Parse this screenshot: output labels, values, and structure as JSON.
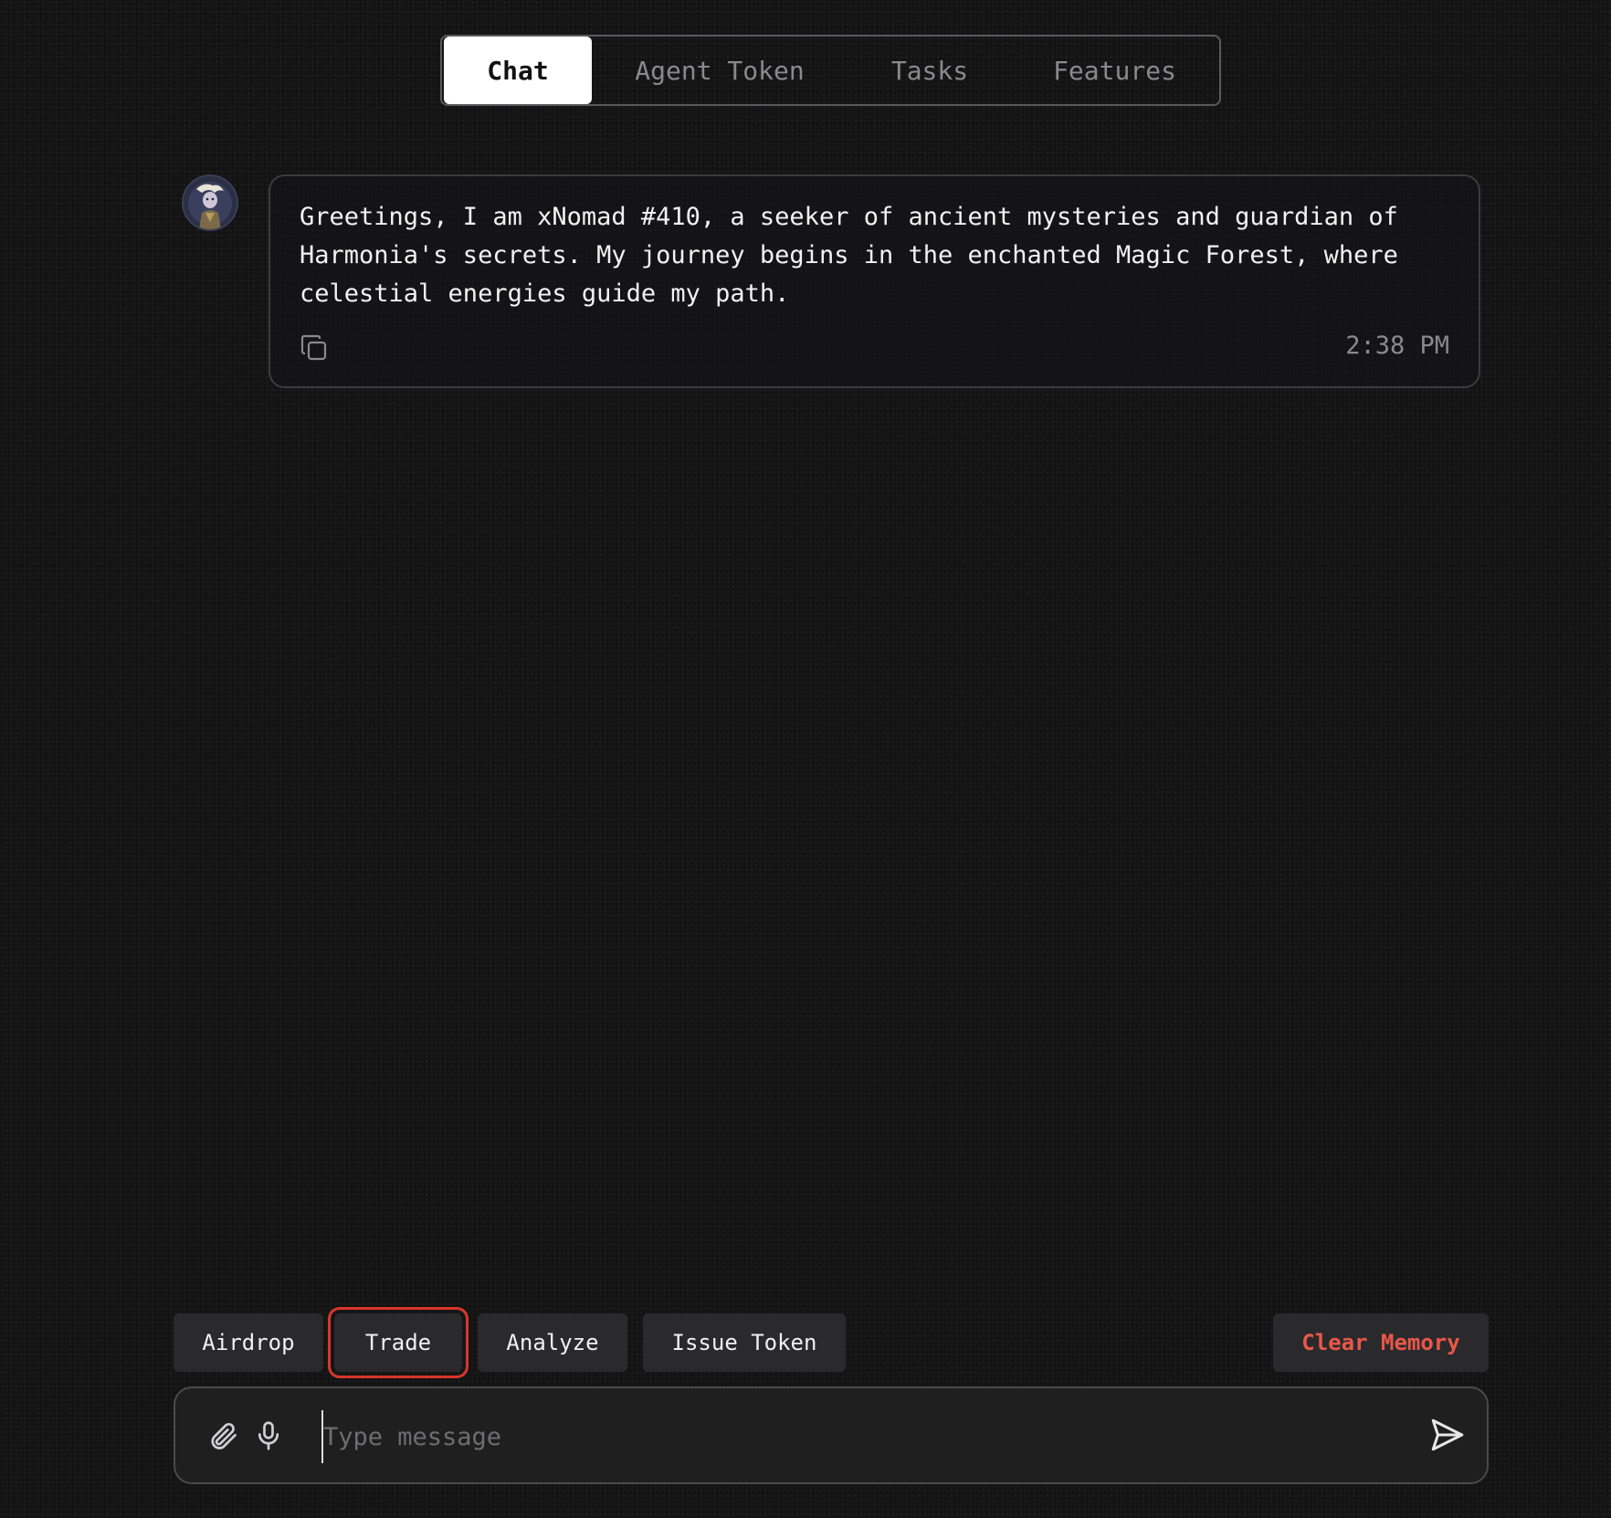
{
  "tabs": {
    "items": [
      {
        "label": "Chat",
        "active": true
      },
      {
        "label": "Agent Token",
        "active": false
      },
      {
        "label": "Tasks",
        "active": false
      },
      {
        "label": "Features",
        "active": false
      }
    ]
  },
  "message": {
    "avatar_icon": "agent-avatar",
    "text": "Greetings, I am xNomad #410, a seeker of ancient mysteries and guardian of\nHarmonia's secrets. My journey begins in the enchanted Magic Forest, where\ncelestial energies guide my path.",
    "timestamp": "2:38 PM",
    "copy_icon": "copy-icon"
  },
  "actions": {
    "airdrop": "Airdrop",
    "trade": "Trade",
    "analyze": "Analyze",
    "issue_token": "Issue Token",
    "clear_memory": "Clear Memory"
  },
  "composer": {
    "placeholder": "Type message",
    "value": "",
    "attach_icon": "paperclip-icon",
    "mic_icon": "microphone-icon",
    "send_icon": "send-icon"
  },
  "colors": {
    "background": "#131314",
    "active_tab_bg": "#ffffff",
    "danger_text": "#e8574a",
    "highlight_outline": "#d9362b"
  }
}
